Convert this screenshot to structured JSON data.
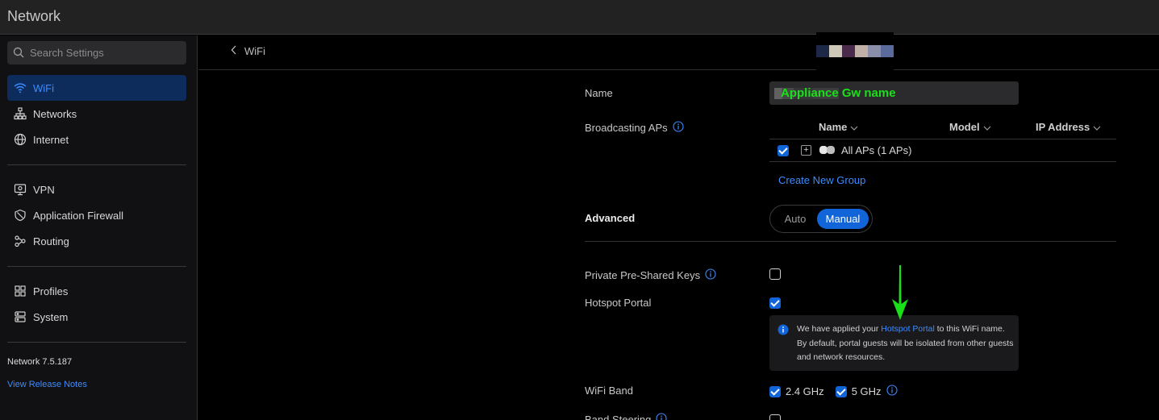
{
  "app": {
    "title": "Network"
  },
  "search": {
    "placeholder": "Search Settings"
  },
  "sidebar": {
    "items": [
      {
        "label": "WiFi",
        "icon": "wifi-icon",
        "active": true
      },
      {
        "label": "Networks",
        "icon": "network-topology-icon"
      },
      {
        "label": "Internet",
        "icon": "globe-icon"
      },
      {
        "label": "VPN",
        "icon": "vpn-icon"
      },
      {
        "label": "Application Firewall",
        "icon": "shield-icon"
      },
      {
        "label": "Routing",
        "icon": "routing-icon"
      },
      {
        "label": "Profiles",
        "icon": "profiles-icon"
      },
      {
        "label": "System",
        "icon": "system-icon"
      }
    ],
    "version": "Network 7.5.187",
    "release_notes": "View Release Notes"
  },
  "header": {
    "back_label": "WiFi"
  },
  "form": {
    "name_label": "Name",
    "name_value": "Appliance Gw name",
    "broadcasting_label": "Broadcasting APs",
    "ap_table": {
      "columns": [
        "Name",
        "Model",
        "IP Address"
      ],
      "rows": [
        {
          "label": "All APs (1 APs)",
          "checked": true
        }
      ]
    },
    "create_group": "Create New Group",
    "advanced_label": "Advanced",
    "advanced_options": [
      "Auto",
      "Manual"
    ],
    "advanced_selected": "Manual",
    "ppsk_label": "Private Pre-Shared Keys",
    "ppsk_checked": false,
    "hotspot_label": "Hotspot Portal",
    "hotspot_checked": true,
    "hotspot_info": {
      "prefix": "We have applied your ",
      "link": "Hotspot Portal",
      "suffix": " to this WiFi name. By default, portal guests will be isolated from other guests and network resources."
    },
    "wifi_band_label": "WiFi Band",
    "bands": [
      {
        "label": "2.4 GHz",
        "checked": true
      },
      {
        "label": "5 GHz",
        "checked": true
      }
    ],
    "band_steering_label": "Band Steering"
  },
  "colors": {
    "accent": "#1265d8",
    "link": "#3d8bff",
    "annotation": "#19e019"
  }
}
